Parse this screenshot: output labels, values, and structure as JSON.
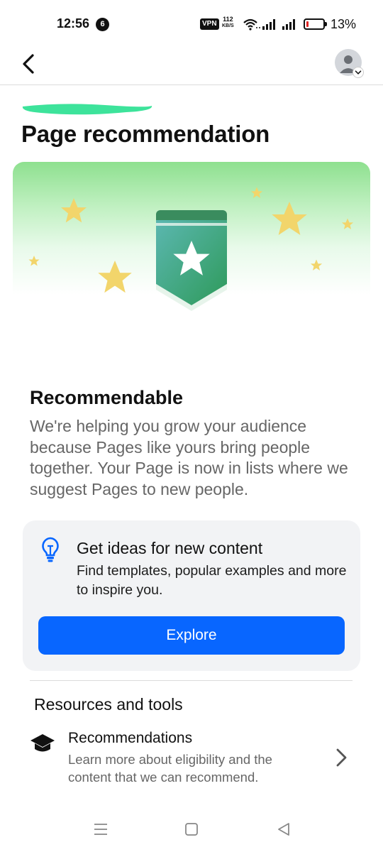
{
  "status_bar": {
    "time": "12:56",
    "notification_count": "6",
    "vpn_label": "VPN",
    "net_speed_value": "112",
    "net_speed_unit": "KB/S",
    "battery_percent": "13%",
    "battery_level": 0.13,
    "battery_color": "#e02424"
  },
  "header": {
    "back_icon": "chevron-left-icon",
    "avatar_icon": "profile-avatar-icon"
  },
  "page": {
    "title": "Page recommendation"
  },
  "hero": {
    "icon": "star-badge-illustration",
    "gradient_top": "#8ee08f"
  },
  "status_section": {
    "title": "Recommendable",
    "description": "We're helping you grow your audience because Pages like yours bring people together. Your Page is now in lists where we suggest Pages to new people."
  },
  "ideas_card": {
    "icon": "lightbulb-icon",
    "title": "Get ideas for new content",
    "description": "Find templates, popular examples and more to inspire you.",
    "button_label": "Explore",
    "button_color": "#0866ff"
  },
  "resources": {
    "heading": "Resources and tools",
    "items": [
      {
        "icon": "graduation-cap-icon",
        "title": "Recommendations",
        "description": "Learn more about eligibility and the content that we can recommend."
      }
    ]
  },
  "nav_bar": {
    "menu_icon": "menu-icon",
    "home_icon": "home-square-icon",
    "back_icon": "back-triangle-icon"
  }
}
